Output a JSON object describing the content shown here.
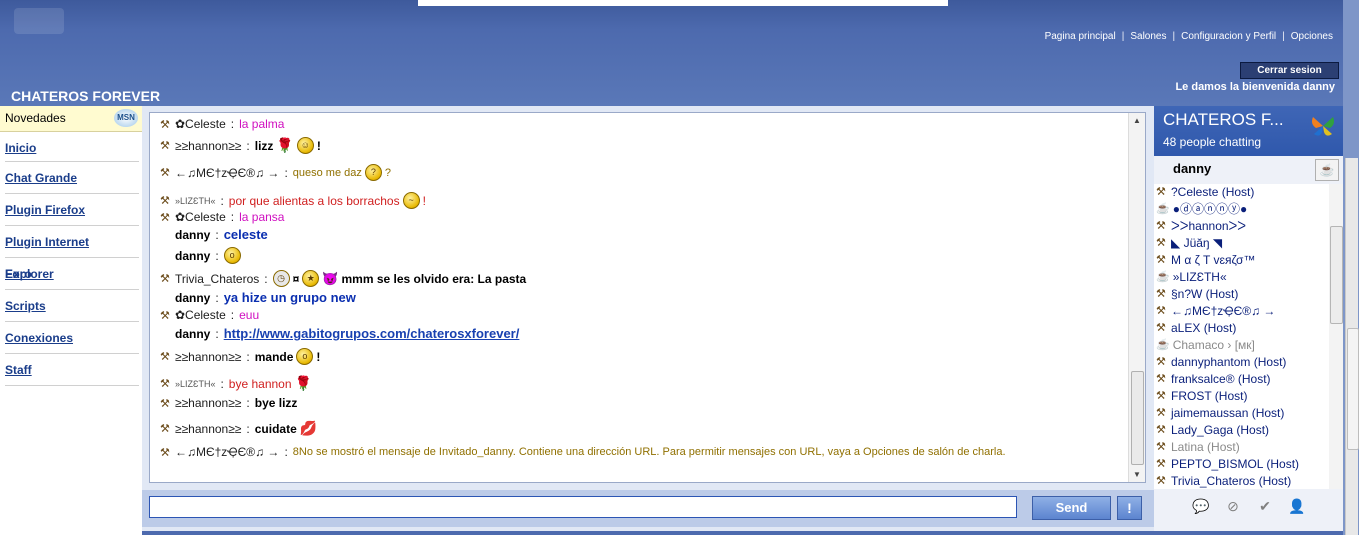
{
  "header": {
    "site_title": "CHATEROS FOREVER",
    "nav": [
      "Pagina principal",
      "Salones",
      "Configuracion y Perfil",
      "Opciones"
    ],
    "logout_label": "Cerrar sesion",
    "welcome": "Le damos la bienvenida danny"
  },
  "sidebar": {
    "novedades": "Novedades",
    "msn_logo": "MSN",
    "links": [
      "Inicio",
      "Chat Grande",
      "Plugin Firefox",
      "Plugin Internet Explorer",
      "Foro",
      "Scripts",
      "Conexiones",
      "Staff"
    ]
  },
  "chat": {
    "messages": [
      {
        "nick": "✿Celeste",
        "text": "la palma"
      },
      {
        "nick": "≥≥hannon≥≥",
        "text": "lizz"
      },
      {
        "nick": "←♫MЄ†zҾЄ®♫ →",
        "text": "queso me daz"
      },
      {
        "nick": "»LIZƐTH«",
        "text": "por que alientas a los borrachos"
      },
      {
        "nick": "✿Celeste",
        "text": "la pansa"
      },
      {
        "nick": "danny",
        "text": "celeste"
      },
      {
        "nick": "danny",
        "text": ""
      },
      {
        "nick": "Trivia_Chateros",
        "text": "mmm se les olvido era: La pasta"
      },
      {
        "nick": "danny",
        "text": "ya hize un grupo new"
      },
      {
        "nick": "✿Celeste",
        "text": "euu"
      },
      {
        "nick": "danny",
        "text": "http://www.gabitogrupos.com/chaterosxforever/"
      },
      {
        "nick": "≥≥hannon≥≥",
        "text": "mande"
      },
      {
        "nick": "»LIZƐTH«",
        "text": "bye hannon"
      },
      {
        "nick": "≥≥hannon≥≥",
        "text": "bye lizz"
      },
      {
        "nick": "≥≥hannon≥≥",
        "text": "cuidate"
      },
      {
        "nick": "←♫MЄ†zҾЄ®♫ →",
        "text": "8No se mostró el mensaje de Invitado_danny. Contiene una dirección URL. Para permitir mensajes con URL, vaya a Opciones de salón de charla."
      }
    ]
  },
  "input": {
    "value": "",
    "send_label": "Send",
    "alert_label": "!"
  },
  "room": {
    "name": "CHATEROS F...",
    "people": "48 people chatting",
    "current_user": "danny"
  },
  "users": [
    {
      "name": "?Celeste (Host)",
      "guest": false
    },
    {
      "name": "●ⓓⓐⓝⓝⓨ●",
      "guest": true
    },
    {
      "name": "ᐳᐳhannonᐳᐳ",
      "guest": false
    },
    {
      "name": "◣ Jüăŋ ◥",
      "guest": false
    },
    {
      "name": "Μ α ζ Τ ᴠɛяζσ™",
      "guest": false
    },
    {
      "name": "»LIZƐTH«",
      "guest": true
    },
    {
      "name": "§n?W (Host)",
      "guest": false
    },
    {
      "name": "←♫MЄ†zҾЄ®♫ →",
      "guest": false
    },
    {
      "name": "aLEX (Host)",
      "guest": false
    },
    {
      "name": "Chamaco › [мк]",
      "guest": true,
      "muted": true
    },
    {
      "name": "dannyphantom (Host)",
      "guest": false
    },
    {
      "name": "franksalce® (Host)",
      "guest": false
    },
    {
      "name": "FROST (Host)",
      "guest": false
    },
    {
      "name": "jaimemaussan (Host)",
      "guest": false
    },
    {
      "name": "Lady_Gaga (Host)",
      "guest": false
    },
    {
      "name": "Latina (Host)",
      "guest": false,
      "muted": true
    },
    {
      "name": "PEPTO_BISMOL (Host)",
      "guest": false
    },
    {
      "name": "Trivia_Chateros (Host)",
      "guest": false
    }
  ],
  "colors": {
    "header_blue": "#4d6aae",
    "room_blue": "#2f58ac",
    "link_blue": "#1a3d8a"
  }
}
